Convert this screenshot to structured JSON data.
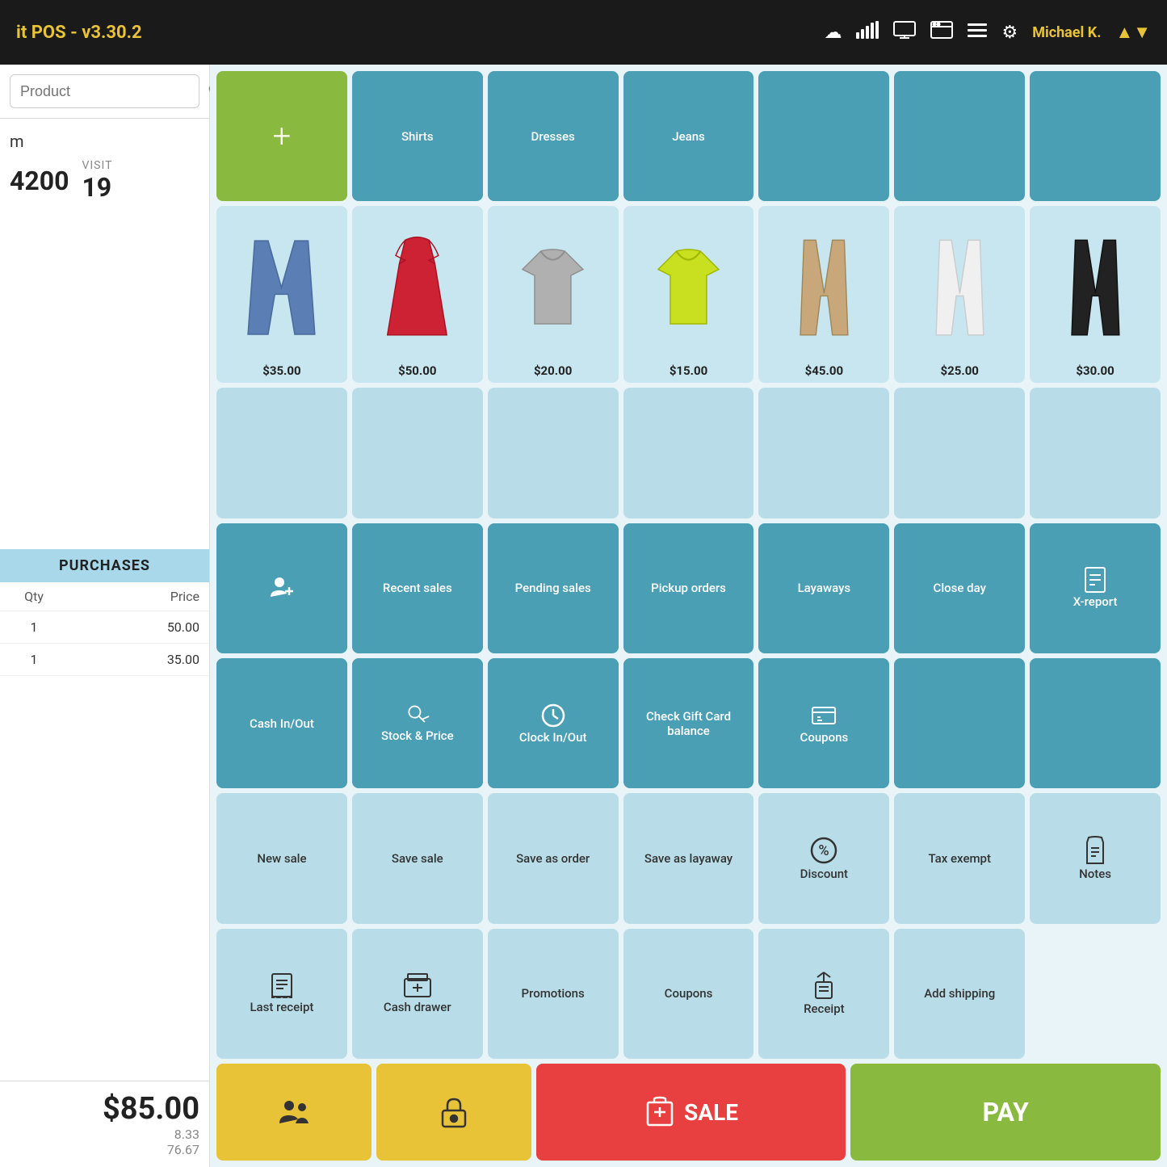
{
  "app": {
    "title": "it POS - v3.30.2",
    "version": "v3.30.2"
  },
  "topbar": {
    "title": "it POS - v3.30.2",
    "user": "Michael K.",
    "icons": [
      "cloud",
      "signal",
      "display",
      "browser",
      "menu",
      "settings"
    ]
  },
  "left": {
    "search_placeholder": "Product",
    "customer_name": "m",
    "customer_number": "4200",
    "visit_label": "VISIT",
    "visit_count": "19",
    "purchases_header": "PURCHASES",
    "col_qty": "Qty",
    "col_price": "Price",
    "rows": [
      {
        "qty": "1",
        "price": "50.00"
      },
      {
        "qty": "1",
        "price": "35.00"
      }
    ],
    "total": "$85.00",
    "subtotal1": "8.33",
    "subtotal2": "76.67"
  },
  "grid": {
    "row1": [
      {
        "label": "+",
        "type": "green",
        "icon": "plus"
      },
      {
        "label": "Shirts",
        "type": "teal"
      },
      {
        "label": "Dresses",
        "type": "teal"
      },
      {
        "label": "Jeans",
        "type": "teal"
      },
      {
        "label": "",
        "type": "teal"
      },
      {
        "label": "",
        "type": "teal"
      },
      {
        "label": "",
        "type": "teal"
      }
    ],
    "row2_products": [
      {
        "price": "$35.00",
        "color": "jeans"
      },
      {
        "price": "$50.00",
        "color": "red_dress"
      },
      {
        "price": "$20.00",
        "color": "gray_shirt"
      },
      {
        "price": "$15.00",
        "color": "yellow_shirt"
      },
      {
        "price": "$45.00",
        "color": "beige_pants"
      },
      {
        "price": "$25.00",
        "color": "white_pants"
      },
      {
        "price": "$30.00",
        "color": "black_pants"
      }
    ],
    "row3_empty": 7,
    "row4": [
      {
        "label": "add customer",
        "type": "teal",
        "icon": "person_plus"
      },
      {
        "label": "Recent sales",
        "type": "teal"
      },
      {
        "label": "Pending sales",
        "type": "teal"
      },
      {
        "label": "Pickup orders",
        "type": "teal"
      },
      {
        "label": "Layaways",
        "type": "teal"
      },
      {
        "label": "Close day",
        "type": "teal"
      },
      {
        "label": "X-report",
        "type": "teal",
        "icon": "document"
      }
    ],
    "row5": [
      {
        "label": "Cash In/Out",
        "type": "teal"
      },
      {
        "label": "Stock & Price",
        "type": "teal",
        "icon": "cart_search"
      },
      {
        "label": "Clock In/Out",
        "type": "teal",
        "icon": "clock"
      },
      {
        "label": "Check Gift Card balance",
        "type": "teal"
      },
      {
        "label": "Coupons",
        "type": "teal",
        "icon": "printer"
      },
      {
        "label": "",
        "type": "teal"
      },
      {
        "label": "",
        "type": "teal"
      }
    ],
    "row6": [
      {
        "label": "New sale",
        "type": "light"
      },
      {
        "label": "Save sale",
        "type": "light"
      },
      {
        "label": "Save as order",
        "type": "light"
      },
      {
        "label": "Save as layaway",
        "type": "light"
      },
      {
        "label": "Discount",
        "type": "light",
        "icon": "percent"
      },
      {
        "label": "Tax exempt",
        "type": "light"
      },
      {
        "label": "Notes",
        "type": "light",
        "icon": "bag"
      }
    ],
    "row7": [
      {
        "label": "Last receipt",
        "type": "light",
        "icon": "printer2"
      },
      {
        "label": "Cash drawer",
        "type": "light",
        "icon": "drawer"
      },
      {
        "label": "Promotions",
        "type": "light"
      },
      {
        "label": "Coupons",
        "type": "light"
      },
      {
        "label": "Receipt",
        "type": "light",
        "icon": "gift"
      },
      {
        "label": "Add shipping",
        "type": "light"
      },
      {
        "label": "",
        "type": "empty"
      }
    ]
  },
  "bottom": {
    "customers_label": "customers",
    "lock_label": "lock",
    "sale_label": "SALE",
    "pay_label": "PAY"
  }
}
